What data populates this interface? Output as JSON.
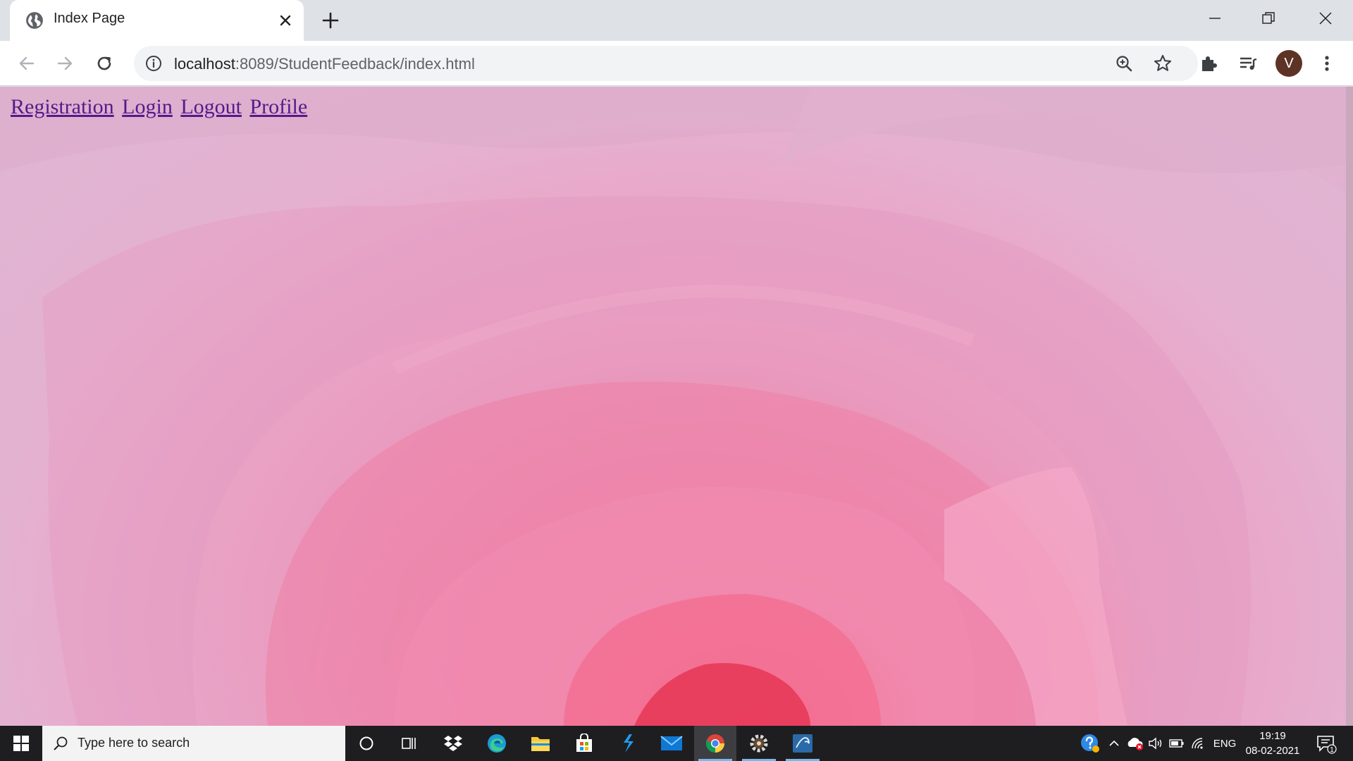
{
  "browser": {
    "tab": {
      "title": "Index Page"
    },
    "address": {
      "host": "localhost",
      "rest": ":8089/StudentFeedback/index.html"
    },
    "profile_initial": "V"
  },
  "page": {
    "links": [
      {
        "label": "Registration"
      },
      {
        "label": "Login"
      },
      {
        "label": "Logout"
      },
      {
        "label": "Profile"
      }
    ],
    "background": "pink rose close-up"
  },
  "taskbar": {
    "search_placeholder": "Type here to search",
    "apps": [
      "cortana-icon",
      "task-view-icon",
      "dropbox-icon",
      "edge-icon",
      "file-explorer-icon",
      "store-icon",
      "vscode-icon",
      "mail-icon",
      "chrome-icon",
      "settings-app-icon",
      "sql-app-icon"
    ],
    "language": "ENG",
    "time": "19:19",
    "date": "08-02-2021",
    "notification_count": "1"
  },
  "colors": {
    "link_visited": "#551a8b",
    "taskbar": "#1e1e21",
    "tabstrip": "#dee1e6",
    "avatar": "#5d3325"
  }
}
